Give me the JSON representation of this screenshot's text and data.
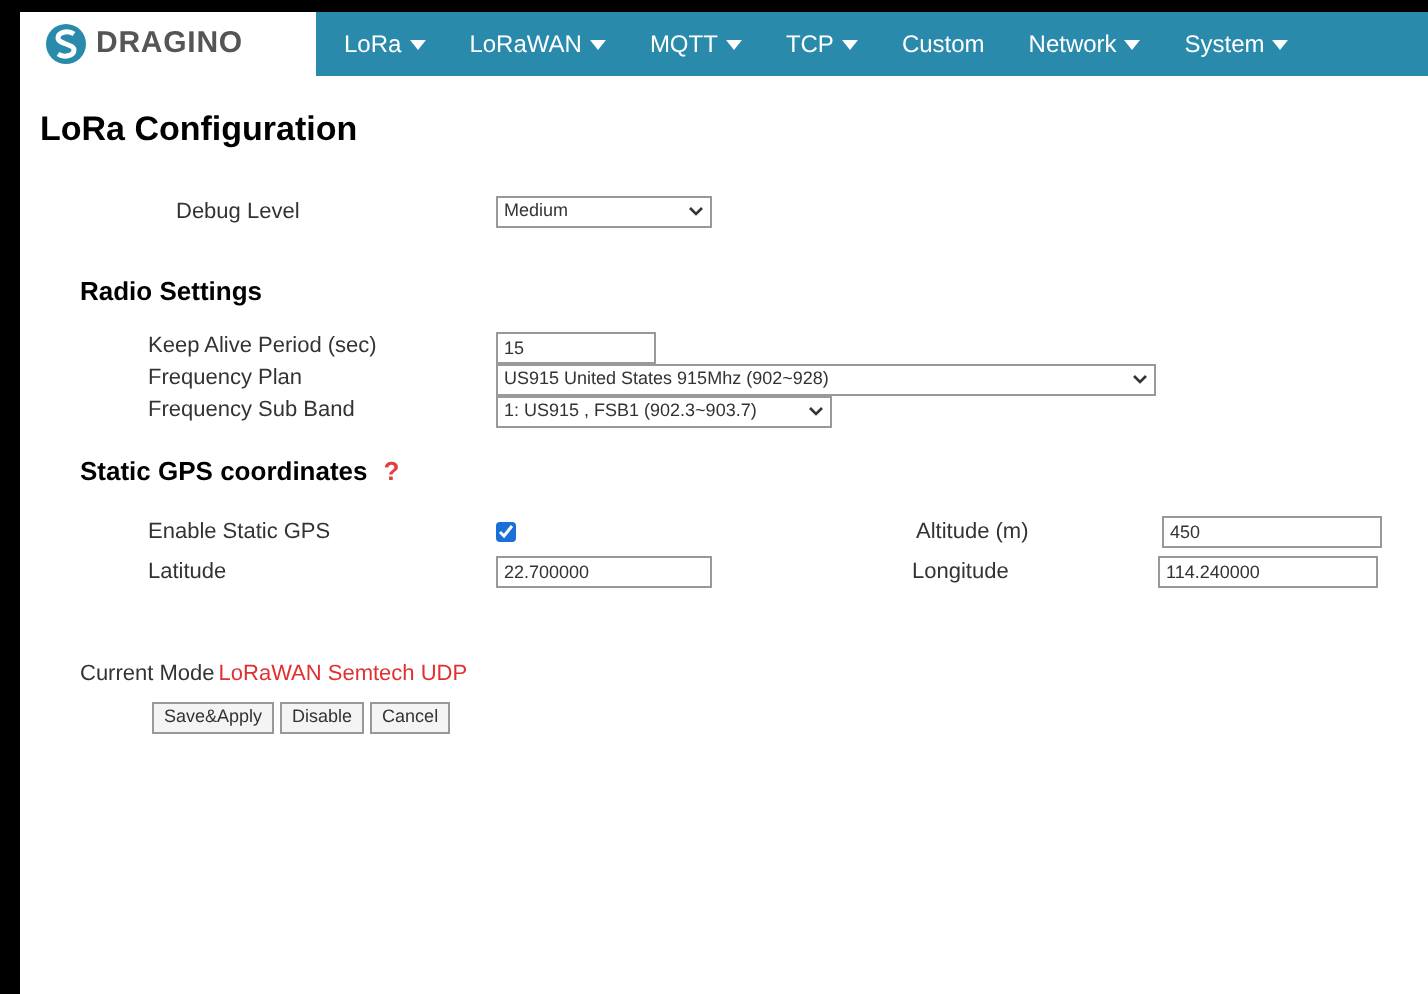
{
  "navbar": {
    "logo": "DRAGINO",
    "items": [
      {
        "label": "LoRa",
        "kind": "dropdown"
      },
      {
        "label": "LoRaWAN",
        "kind": "dropdown"
      },
      {
        "label": "MQTT",
        "kind": "dropdown"
      },
      {
        "label": "TCP",
        "kind": "dropdown"
      },
      {
        "label": "Custom",
        "kind": "link"
      },
      {
        "label": "Network",
        "kind": "dropdown"
      },
      {
        "label": "System",
        "kind": "dropdown"
      }
    ]
  },
  "title": "LoRa Configuration",
  "debug": {
    "label": "Debug Level",
    "value": "Medium"
  },
  "radio": {
    "heading": "Radio Settings",
    "rows": [
      {
        "label": "Keep Alive Period (sec)",
        "kind": "text",
        "value": "15"
      },
      {
        "label": "Frequency Plan",
        "kind": "select",
        "value": "US915 United States 915Mhz (902~928)"
      },
      {
        "label": "Frequency Sub Band",
        "kind": "select",
        "value": "1: US915 , FSB1 (902.3~903.7)"
      }
    ]
  },
  "gps": {
    "heading": "Static GPS coordinates",
    "help": "?",
    "enable": {
      "label": "Enable Static GPS",
      "checked": true
    },
    "altitude": {
      "label": "Altitude (m)",
      "value": "450"
    },
    "latitude": {
      "label": "Latitude",
      "value": "22.700000"
    },
    "longitude": {
      "label": "Longitude",
      "value": "114.240000"
    }
  },
  "mode": {
    "label": "Current Mode",
    "value": "LoRaWAN Semtech UDP"
  },
  "buttons": [
    "Save&Apply",
    "Disable",
    "Cancel"
  ]
}
